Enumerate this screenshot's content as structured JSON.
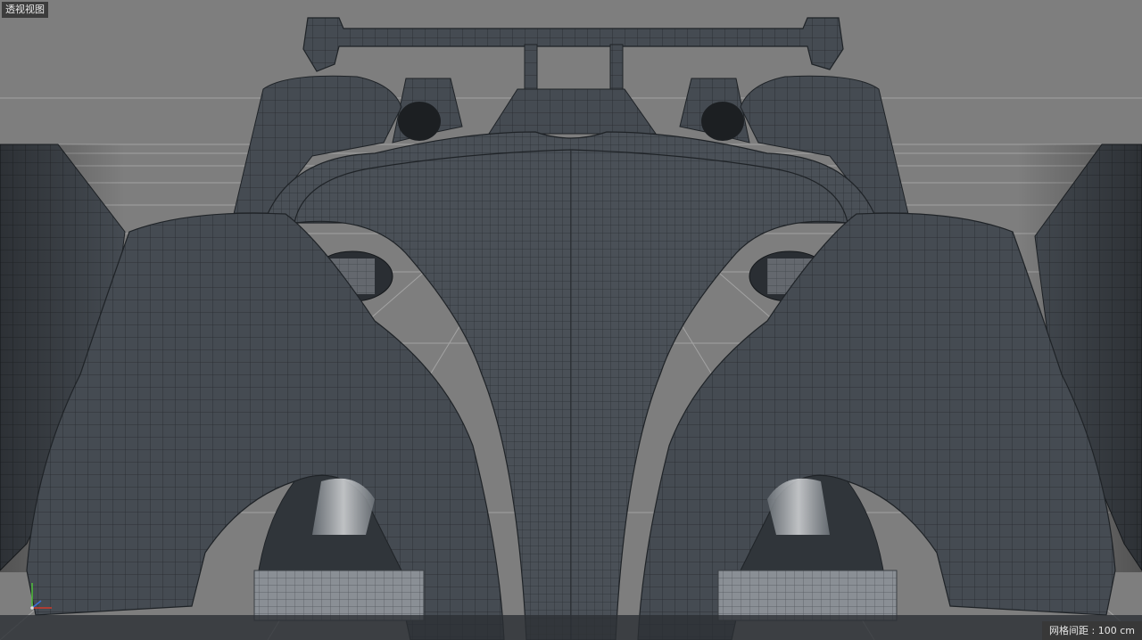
{
  "viewport": {
    "view_name": "透视视图",
    "grid_spacing": "网格间距 : 100 cm"
  },
  "colors": {
    "background": "#7e7e7e",
    "model_surface": "#454b52",
    "wire": "#23272b",
    "grid_line": "#9a9a9a",
    "axis_x": "#d23a2a",
    "axis_y": "#4fbf3a",
    "axis_z": "#3a6fd8"
  },
  "icons": {
    "axis_gizmo": "xyz-axis-icon"
  }
}
